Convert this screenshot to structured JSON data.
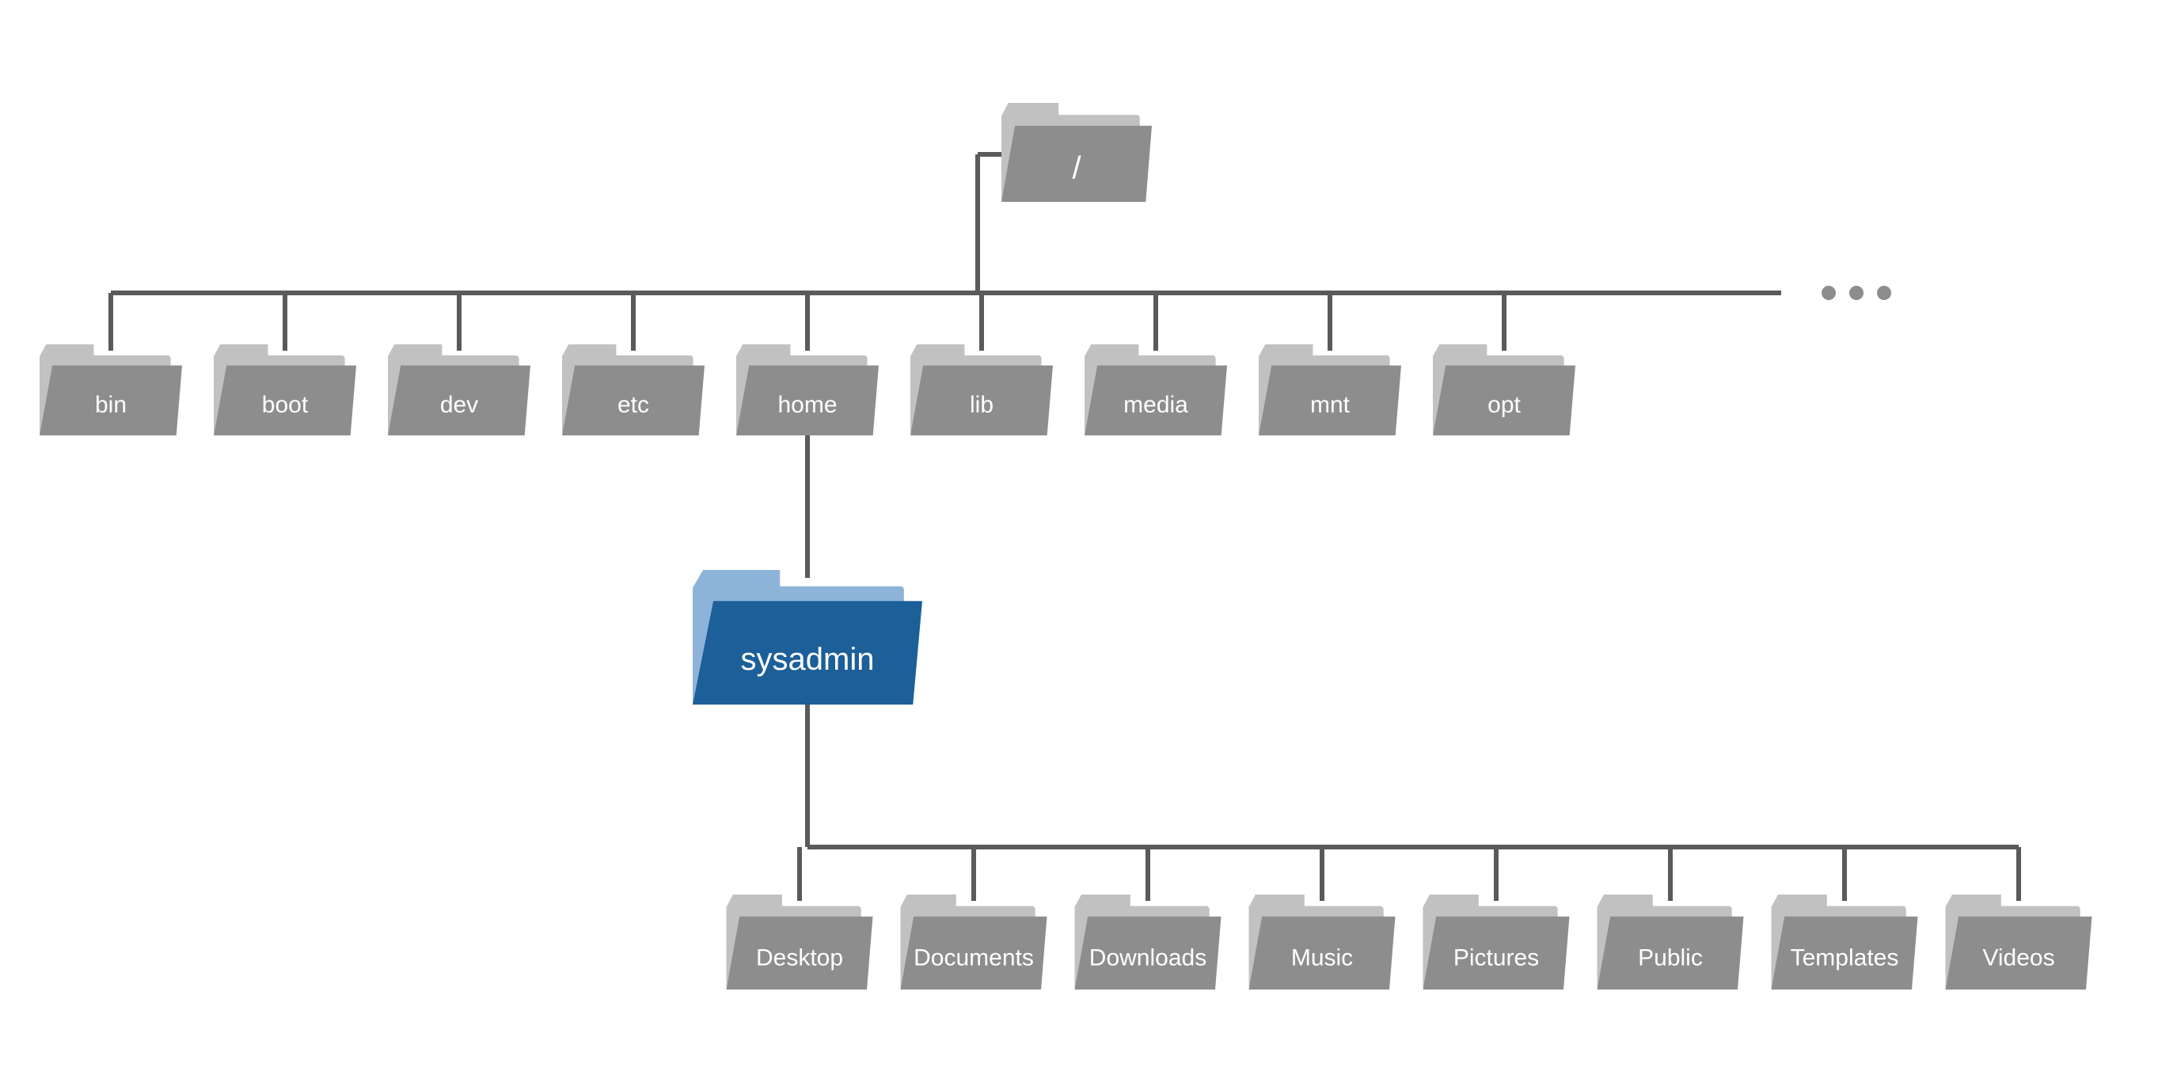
{
  "tree": {
    "root": {
      "label": "/",
      "highlighted": false
    },
    "level1": [
      {
        "label": "bin",
        "highlighted": false
      },
      {
        "label": "boot",
        "highlighted": false
      },
      {
        "label": "dev",
        "highlighted": false
      },
      {
        "label": "etc",
        "highlighted": false
      },
      {
        "label": "home",
        "highlighted": false
      },
      {
        "label": "lib",
        "highlighted": false
      },
      {
        "label": "media",
        "highlighted": false
      },
      {
        "label": "mnt",
        "highlighted": false
      },
      {
        "label": "opt",
        "highlighted": false
      }
    ],
    "level1_has_more": true,
    "level2": [
      {
        "label": "sysadmin",
        "highlighted": true
      }
    ],
    "level3": [
      {
        "label": "Desktop",
        "highlighted": false
      },
      {
        "label": "Documents",
        "highlighted": false
      },
      {
        "label": "Downloads",
        "highlighted": false
      },
      {
        "label": "Music",
        "highlighted": false
      },
      {
        "label": "Pictures",
        "highlighted": false
      },
      {
        "label": "Public",
        "highlighted": false
      },
      {
        "label": "Templates",
        "highlighted": false
      },
      {
        "label": "Videos",
        "highlighted": false
      }
    ]
  },
  "colors": {
    "folder_light": "#c1c1c1",
    "folder_body": "#8d8d8d",
    "highlight_light": "#8db3d9",
    "highlight_body": "#1c5f99",
    "connector": "#5a5a5a"
  }
}
